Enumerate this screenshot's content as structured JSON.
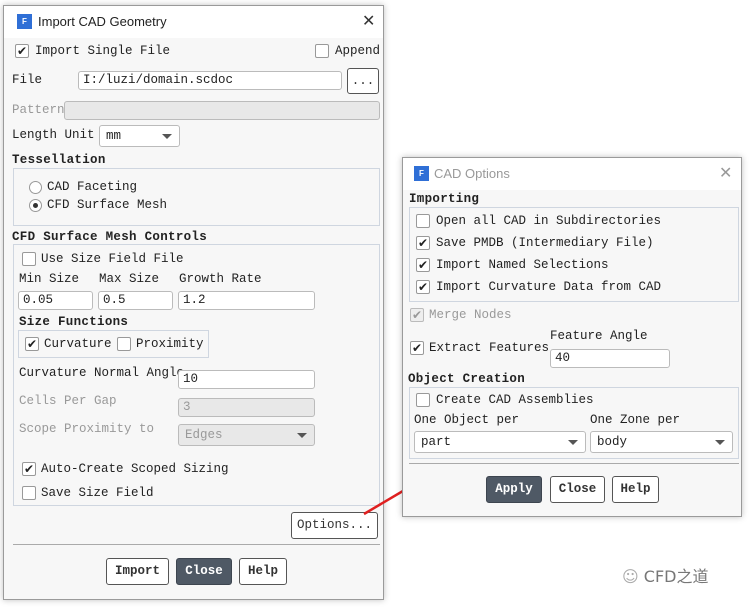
{
  "import_dialog": {
    "title": "Import CAD Geometry",
    "import_single_file": {
      "label": "Import Single File",
      "checked": true
    },
    "append": {
      "label": "Append",
      "checked": false
    },
    "file": {
      "label": "File",
      "value": "I:/luzi/domain.scdoc",
      "browse_label": "..."
    },
    "pattern": {
      "label": "Pattern",
      "value": ""
    },
    "length_unit": {
      "label": "Length Unit",
      "value": "mm"
    },
    "tessellation": {
      "title": "Tessellation",
      "options": [
        "CAD Faceting",
        "CFD Surface Mesh"
      ],
      "selected": "CFD Surface Mesh"
    },
    "mesh_controls": {
      "title": "CFD Surface Mesh Controls",
      "use_size_field": {
        "label": "Use Size Field File",
        "checked": false
      },
      "min_size": {
        "label": "Min Size",
        "value": "0.05"
      },
      "max_size": {
        "label": "Max Size",
        "value": "0.5"
      },
      "growth_rate": {
        "label": "Growth Rate",
        "value": "1.2"
      },
      "size_functions": {
        "title": "Size Functions",
        "curvature": {
          "label": "Curvature",
          "checked": true
        },
        "proximity": {
          "label": "Proximity",
          "checked": false
        }
      },
      "curvature_normal_angle": {
        "label": "Curvature Normal Angle",
        "value": "10"
      },
      "cells_per_gap": {
        "label": "Cells Per Gap",
        "value": "3"
      },
      "scope_proximity": {
        "label": "Scope Proximity to",
        "value": "Edges"
      },
      "auto_create": {
        "label": "Auto-Create Scoped Sizing",
        "checked": true
      },
      "save_size_field": {
        "label": "Save Size Field",
        "checked": false
      }
    },
    "options_label": "Options...",
    "buttons": {
      "import": "Import",
      "close": "Close",
      "help": "Help"
    }
  },
  "cad_options": {
    "title": "CAD Options",
    "importing": {
      "title": "Importing",
      "items": [
        {
          "label": "Open all CAD in Subdirectories",
          "checked": false
        },
        {
          "label": "Save PMDB (Intermediary File)",
          "checked": true
        },
        {
          "label": "Import Named Selections",
          "checked": true
        },
        {
          "label": "Import Curvature Data from CAD",
          "checked": true
        }
      ]
    },
    "merge_nodes": {
      "label": "Merge Nodes",
      "checked": true,
      "disabled": true
    },
    "extract_features": {
      "label": "Extract Features",
      "checked": true
    },
    "feature_angle": {
      "label": "Feature Angle",
      "value": "40"
    },
    "object_creation": {
      "title": "Object Creation",
      "create_assemblies": {
        "label": "Create CAD Assemblies",
        "checked": false
      },
      "one_object_per": {
        "label": "One Object per",
        "value": "part"
      },
      "one_zone_per": {
        "label": "One Zone per",
        "value": "body"
      }
    },
    "buttons": {
      "apply": "Apply",
      "close": "Close",
      "help": "Help"
    }
  },
  "watermark": "CFD之道",
  "colors": {
    "accent": "#4f5965",
    "arrow": "#e02020",
    "icon": "#2f6fd6"
  }
}
